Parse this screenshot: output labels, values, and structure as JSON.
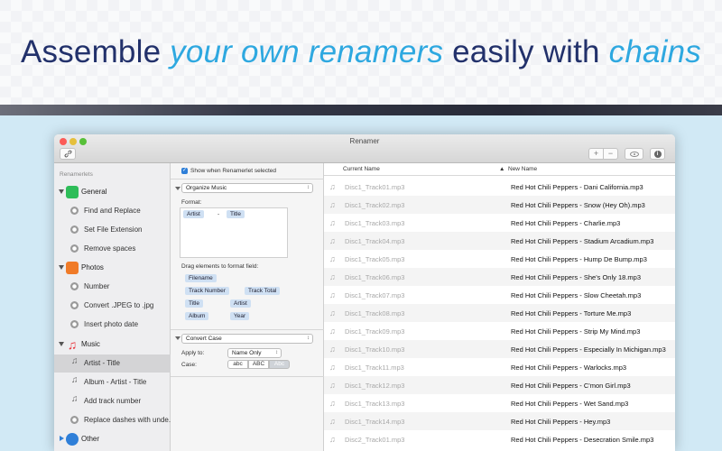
{
  "headline": {
    "part1": "Assemble ",
    "part2": "your own renamers",
    "part3": " easily with ",
    "part4": "chains"
  },
  "window": {
    "title": "Renamer",
    "toolbar": {
      "link_icon": "link-icon",
      "plus": "+",
      "minus": "−",
      "eye_icon": "eye-icon",
      "info": "i"
    }
  },
  "sidebar": {
    "header": "Renamerlets",
    "groups": [
      {
        "label": "General",
        "icon": "cube-icon",
        "color": "#2ebd59"
      },
      {
        "label": "Photos",
        "icon": "photo-icon",
        "color": "#f07b28"
      },
      {
        "label": "Music",
        "icon": "music-note-icon",
        "color": "#e8353d"
      },
      {
        "label": "Other",
        "icon": "gear-icon",
        "color": "#2f7fd8"
      }
    ],
    "items": [
      {
        "label": "Find and Replace"
      },
      {
        "label": "Set File Extension"
      },
      {
        "label": "Remove spaces"
      },
      {
        "label": "Number"
      },
      {
        "label": "Convert .JPEG to .jpg"
      },
      {
        "label": "Insert photo date"
      },
      {
        "label": "Artist - Title"
      },
      {
        "label": "Album - Artist - Title"
      },
      {
        "label": "Add track number"
      },
      {
        "label": "Replace dashes with unde..."
      }
    ]
  },
  "middle": {
    "show_checkbox": "Show when Renamerlet selected",
    "step1": {
      "select": "Organize Music",
      "format_label": "Format:",
      "tokens": [
        "Artist",
        "-",
        "Title"
      ],
      "drag_label": "Drag elements to format field:",
      "elements": [
        "Filename",
        "Track Number",
        "Track Total",
        "Title",
        "Artist",
        "Album",
        "Year"
      ]
    },
    "step2": {
      "select": "Convert Case",
      "apply_label": "Apply to:",
      "apply_value": "Name Only",
      "case_label": "Case:",
      "case_options": [
        "abc",
        "ABC",
        "Abc"
      ]
    }
  },
  "files": {
    "col_current": "Current Name",
    "col_new": "New Name",
    "rows": [
      {
        "current": "Disc1_Track01.mp3",
        "new": "Red Hot Chili Peppers - Dani California.mp3"
      },
      {
        "current": "Disc1_Track02.mp3",
        "new": "Red Hot Chili Peppers - Snow (Hey Oh).mp3"
      },
      {
        "current": "Disc1_Track03.mp3",
        "new": "Red Hot Chili Peppers - Charlie.mp3"
      },
      {
        "current": "Disc1_Track04.mp3",
        "new": "Red Hot Chili Peppers - Stadium Arcadium.mp3"
      },
      {
        "current": "Disc1_Track05.mp3",
        "new": "Red Hot Chili Peppers - Hump De Bump.mp3"
      },
      {
        "current": "Disc1_Track06.mp3",
        "new": "Red Hot Chili Peppers - She's Only 18.mp3"
      },
      {
        "current": "Disc1_Track07.mp3",
        "new": "Red Hot Chili Peppers - Slow Cheetah.mp3"
      },
      {
        "current": "Disc1_Track08.mp3",
        "new": "Red Hot Chili Peppers - Torture Me.mp3"
      },
      {
        "current": "Disc1_Track09.mp3",
        "new": "Red Hot Chili Peppers - Strip My Mind.mp3"
      },
      {
        "current": "Disc1_Track10.mp3",
        "new": "Red Hot Chili Peppers - Especially In Michigan.mp3"
      },
      {
        "current": "Disc1_Track11.mp3",
        "new": "Red Hot Chili Peppers - Warlocks.mp3"
      },
      {
        "current": "Disc1_Track12.mp3",
        "new": "Red Hot Chili Peppers - C'mon Girl.mp3"
      },
      {
        "current": "Disc1_Track13.mp3",
        "new": "Red Hot Chili Peppers - Wet Sand.mp3"
      },
      {
        "current": "Disc1_Track14.mp3",
        "new": "Red Hot Chili Peppers - Hey.mp3"
      },
      {
        "current": "Disc2_Track01.mp3",
        "new": "Red Hot Chili Peppers - Desecration Smile.mp3"
      }
    ]
  }
}
